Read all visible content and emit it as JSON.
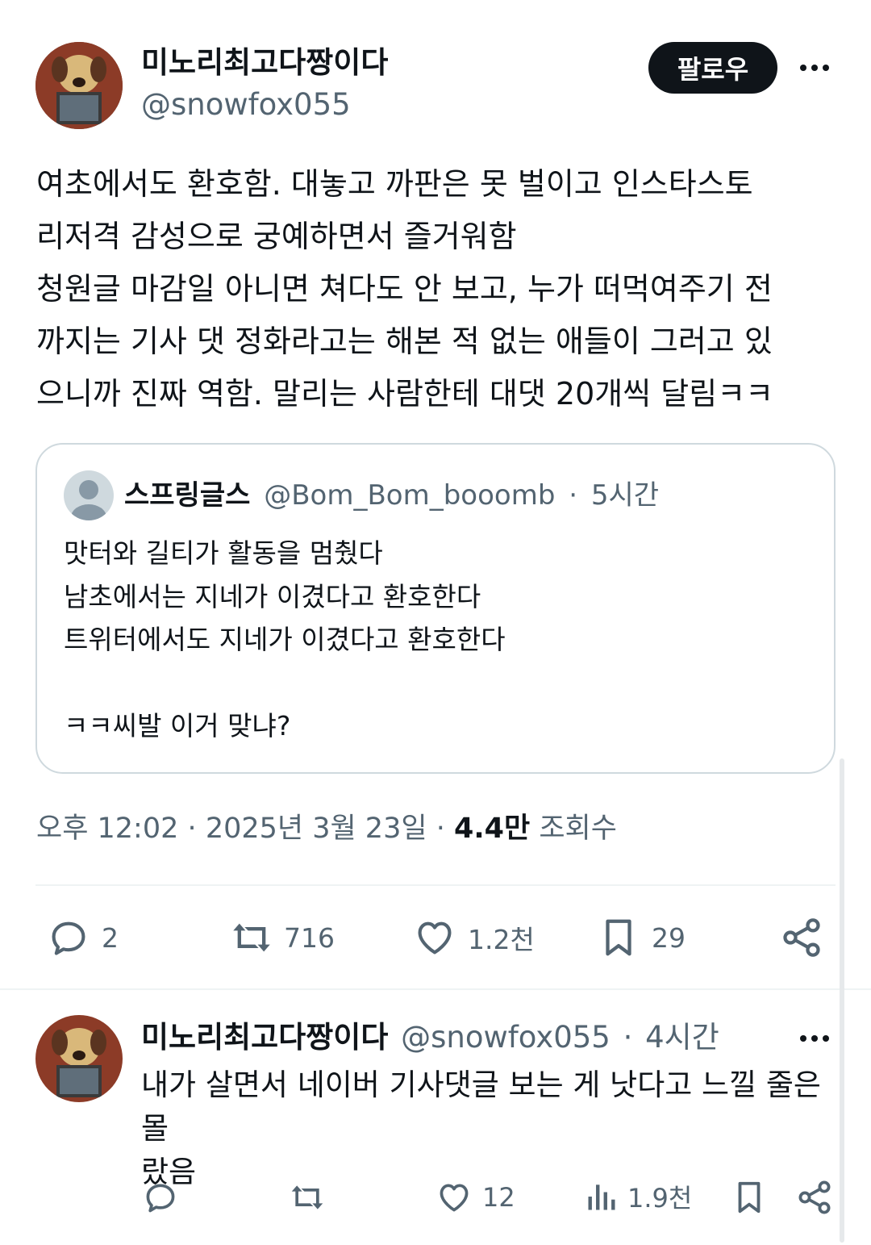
{
  "main_tweet": {
    "author_name": "미노리최고다짱이다",
    "handle": "@snowfox055",
    "follow_label": "팔로우",
    "body": "여초에서도 환호함. 대놓고 까판은 못 벌이고 인스타스토\n리저격 감성으로 궁예하면서 즐거워함\n청원글 마감일 아니면 쳐다도 안 보고, 누가 떠먹여주기 전\n까지는 기사 댓 정화라고는 해본 적 없는 애들이 그러고 있\n으니까 진짜 역함. 말리는 사람한테 대댓 20개씩 달림ㅋㅋ",
    "quoted": {
      "author_name": "스프링글스",
      "handle": "@Bom_Bom_booomb",
      "separator": "·",
      "time": "5시간",
      "lines": [
        "맛터와 길티가 활동을 멈췄다",
        "남초에서는 지네가 이겼다고 환호한다",
        "트위터에서도 지네가 이겼다고 환호한다",
        "",
        "ㅋㅋ씨발 이거 맞냐?"
      ]
    },
    "meta": {
      "time": "오후 12:02",
      "sep1": "·",
      "date": "2025년 3월 23일",
      "sep2": "·",
      "views_count": "4.4만",
      "views_label": "조회수"
    },
    "actions": {
      "replies": "2",
      "retweets": "716",
      "likes": "1.2천",
      "bookmarks": "29"
    }
  },
  "reply": {
    "author_name": "미노리최고다짱이다",
    "handle": "@snowfox055",
    "separator": "·",
    "time": "4시간",
    "body": "내가 살면서 네이버 기사댓글 보는 게 낫다고 느낄 줄은 몰\n랐음",
    "actions": {
      "likes": "12",
      "views": "1.9천"
    }
  },
  "icons": {
    "more": "more-horizontal-icon",
    "reply": "reply-bubble-icon",
    "retweet": "retweet-icon",
    "like": "heart-icon",
    "bookmark": "bookmark-icon",
    "share": "share-icon",
    "views": "analytics-icon"
  }
}
